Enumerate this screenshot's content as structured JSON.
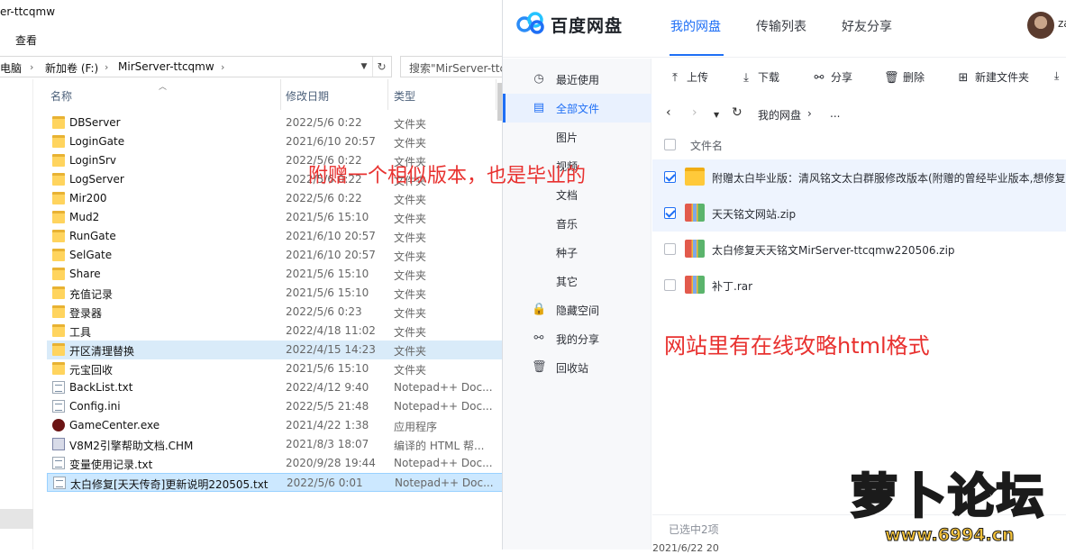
{
  "explorer": {
    "title": "er-ttcqmw",
    "ribbon_tab": "查看",
    "address": [
      "电脑",
      "新加卷 (F:)",
      "MirServer-ttcqmw"
    ],
    "search_placeholder": "搜索\"MirServer-ttcq",
    "columns": {
      "name": "名称",
      "date": "修改日期",
      "type": "类型"
    },
    "files": [
      {
        "name": "DBServer",
        "date": "2022/5/6 0:22",
        "type": "文件夹",
        "icon": "folder"
      },
      {
        "name": "LoginGate",
        "date": "2021/6/10 20:57",
        "type": "文件夹",
        "icon": "folder"
      },
      {
        "name": "LoginSrv",
        "date": "2022/5/6 0:22",
        "type": "文件夹",
        "icon": "folder"
      },
      {
        "name": "LogServer",
        "date": "2022/5/6 0:22",
        "type": "文件夹",
        "icon": "folder"
      },
      {
        "name": "Mir200",
        "date": "2022/5/6 0:22",
        "type": "文件夹",
        "icon": "folder"
      },
      {
        "name": "Mud2",
        "date": "2021/5/6 15:10",
        "type": "文件夹",
        "icon": "folder"
      },
      {
        "name": "RunGate",
        "date": "2021/6/10 20:57",
        "type": "文件夹",
        "icon": "folder"
      },
      {
        "name": "SelGate",
        "date": "2021/6/10 20:57",
        "type": "文件夹",
        "icon": "folder"
      },
      {
        "name": "Share",
        "date": "2021/5/6 15:10",
        "type": "文件夹",
        "icon": "folder"
      },
      {
        "name": "充值记录",
        "date": "2021/5/6 15:10",
        "type": "文件夹",
        "icon": "folder"
      },
      {
        "name": "登录器",
        "date": "2022/5/6 0:23",
        "type": "文件夹",
        "icon": "folder"
      },
      {
        "name": "工具",
        "date": "2022/4/18 11:02",
        "type": "文件夹",
        "icon": "folder"
      },
      {
        "name": "开区清理替换",
        "date": "2022/4/15 14:23",
        "type": "文件夹",
        "icon": "folder"
      },
      {
        "name": "元宝回收",
        "date": "2021/5/6 15:10",
        "type": "文件夹",
        "icon": "folder"
      },
      {
        "name": "BackList.txt",
        "date": "2022/4/12 9:40",
        "type": "Notepad++ Doc...",
        "icon": "txt"
      },
      {
        "name": "Config.ini",
        "date": "2022/5/5 21:48",
        "type": "Notepad++ Doc...",
        "icon": "txt"
      },
      {
        "name": "GameCenter.exe",
        "date": "2021/4/22 1:38",
        "type": "应用程序",
        "icon": "exe"
      },
      {
        "name": "V8M2引擎帮助文档.CHM",
        "date": "2021/8/3 18:07",
        "type": "编译的 HTML 帮...",
        "icon": "chm"
      },
      {
        "name": "变量使用记录.txt",
        "date": "2020/9/28 19:44",
        "type": "Notepad++ Doc...",
        "icon": "txt"
      },
      {
        "name": "太白修复[天天传奇]更新说明220505.txt",
        "date": "2022/5/6 0:01",
        "type": "Notepad++ Doc...",
        "icon": "txt"
      }
    ]
  },
  "baidu": {
    "logo_text": "百度网盘",
    "tabs": [
      "我的网盘",
      "传输列表",
      "好友分享"
    ],
    "user": "za",
    "sidebar": [
      {
        "label": "最近使用",
        "icon": "clock-icon",
        "glyph": "◷"
      },
      {
        "label": "全部文件",
        "icon": "document-icon",
        "glyph": "▤"
      },
      {
        "label": "图片",
        "icon": "",
        "glyph": ""
      },
      {
        "label": "视频",
        "icon": "",
        "glyph": ""
      },
      {
        "label": "文档",
        "icon": "",
        "glyph": ""
      },
      {
        "label": "音乐",
        "icon": "",
        "glyph": ""
      },
      {
        "label": "种子",
        "icon": "",
        "glyph": ""
      },
      {
        "label": "其它",
        "icon": "",
        "glyph": ""
      },
      {
        "label": "隐藏空间",
        "icon": "lock-icon",
        "glyph": "🔒"
      },
      {
        "label": "我的分享",
        "icon": "share-icon",
        "glyph": "⚯"
      },
      {
        "label": "回收站",
        "icon": "trash-icon",
        "glyph": "🗑"
      }
    ],
    "toolbar": {
      "upload": "上传",
      "download": "下载",
      "share": "分享",
      "delete": "删除",
      "new_folder": "新建文件夹"
    },
    "breadcrumb": {
      "root": "我的网盘",
      "chevron": "›",
      "more": "..."
    },
    "list_header": "文件名",
    "files": [
      {
        "name": "附赠太白毕业版：清风铭文太白群服修改版本(附赠的曾经毕业版本,想修复...",
        "type": "folder",
        "checked": true
      },
      {
        "name": "天天铭文网站.zip",
        "type": "zip",
        "checked": true
      },
      {
        "name": "太白修复天天铭文MirServer-ttcqmw220506.zip",
        "type": "zip",
        "checked": false
      },
      {
        "name": "补丁.rar",
        "type": "zip",
        "checked": false
      }
    ],
    "status": "已选中2项",
    "footer_date": "2021/6/22 20"
  },
  "annotations": {
    "top": "附赠一个相似版本，也是毕业的",
    "bottom": "网站里有在线攻略html格式"
  },
  "watermark": {
    "text": "萝卜论坛",
    "url": "www.6994.cn"
  },
  "colors": {
    "accent": "#1f6ff5",
    "annotation": "#e8312f",
    "selected_row": "#cce8ff"
  }
}
